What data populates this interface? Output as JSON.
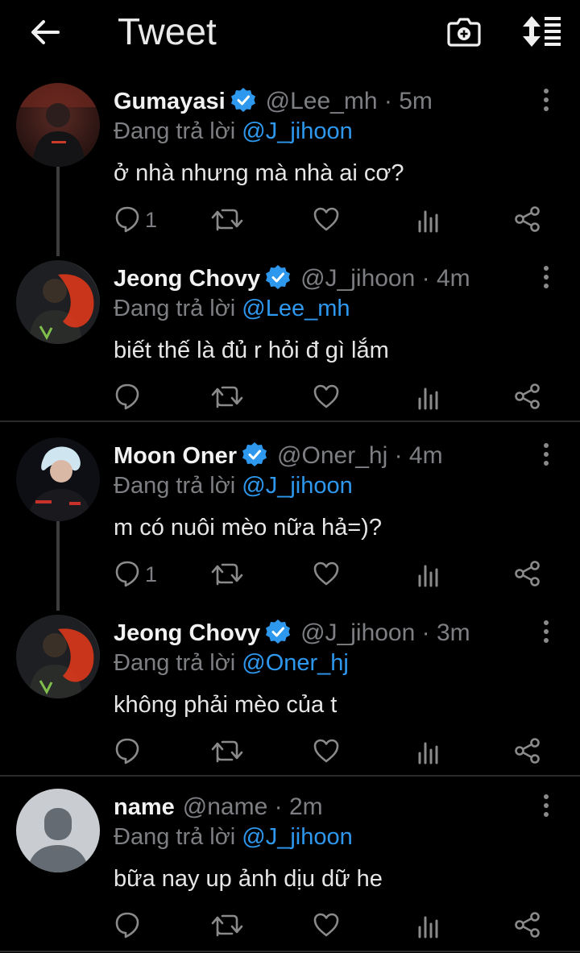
{
  "header": {
    "title": "Tweet"
  },
  "reply_prefix": "Đang trả lời",
  "tweets": [
    {
      "name": "Gumayasi",
      "verified": true,
      "handle": "@Lee_mh",
      "time": "5m",
      "reply_to": "@J_jihoon",
      "text": "ở nhà nhưng mà nhà ai cơ?",
      "reply_count": "1"
    },
    {
      "name": "Jeong Chovy",
      "verified": true,
      "handle": "@J_jihoon",
      "time": "4m",
      "reply_to": "@Lee_mh",
      "text": "biết thế là đủ r hỏi đ gì lắm",
      "reply_count": ""
    },
    {
      "name": "Moon Oner",
      "verified": true,
      "handle": "@Oner_hj",
      "time": "4m",
      "reply_to": "@J_jihoon",
      "text": "m có nuôi mèo nữa hả=)?",
      "reply_count": "1"
    },
    {
      "name": "Jeong Chovy",
      "verified": true,
      "handle": "@J_jihoon",
      "time": "3m",
      "reply_to": "@Oner_hj",
      "text": "không phải mèo của t",
      "reply_count": ""
    },
    {
      "name": "name",
      "verified": false,
      "handle": "@name",
      "time": "2m",
      "reply_to": "@J_jihoon",
      "text": "bữa nay up ảnh dịu dữ he",
      "reply_count": ""
    }
  ],
  "separator": "·",
  "colors": {
    "accent": "#2e98ef",
    "muted": "#7d7f83",
    "background": "#000000"
  }
}
